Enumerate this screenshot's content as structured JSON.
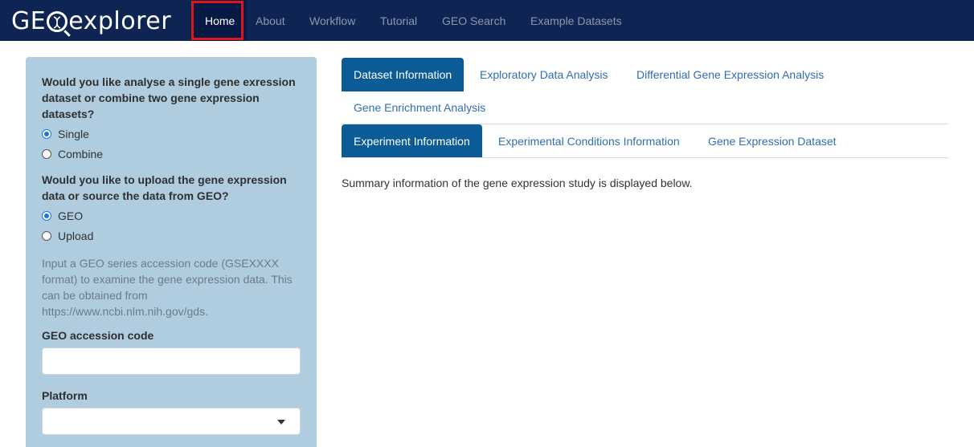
{
  "navbar": {
    "brand_prefix": "GE",
    "brand_suffix": "explorer",
    "items": [
      {
        "label": "Home",
        "active": true
      },
      {
        "label": "About"
      },
      {
        "label": "Workflow"
      },
      {
        "label": "Tutorial"
      },
      {
        "label": "GEO Search"
      },
      {
        "label": "Example Datasets"
      }
    ]
  },
  "sidebar": {
    "q1": "Would you like analyse a single gene exression dataset or combine two gene expression datasets?",
    "q1_options": [
      {
        "label": "Single",
        "checked": true
      },
      {
        "label": "Combine",
        "checked": false
      }
    ],
    "q2": "Would you like to upload the gene expression data or source the data from GEO?",
    "q2_options": [
      {
        "label": "GEO",
        "checked": true
      },
      {
        "label": "Upload",
        "checked": false
      }
    ],
    "help_text": "Input a GEO series accession code (GSEXXXX format) to examine the gene expression data. This can be obtained from https://www.ncbi.nlm.nih.gov/gds.",
    "accession_label": "GEO accession code",
    "accession_value": "",
    "platform_label": "Platform",
    "platform_value": ""
  },
  "main": {
    "tabs": [
      {
        "label": "Dataset Information",
        "active": true
      },
      {
        "label": "Exploratory Data Analysis"
      },
      {
        "label": "Differential Gene Expression Analysis"
      },
      {
        "label": "Gene Enrichment Analysis"
      }
    ],
    "subtabs": [
      {
        "label": "Experiment Information",
        "active": true
      },
      {
        "label": "Experimental Conditions Information"
      },
      {
        "label": "Gene Expression Dataset"
      }
    ],
    "summary": "Summary information of the gene expression study is displayed below."
  },
  "colors": {
    "navbar_bg": "#0e2453",
    "active_tab": "#0b5c96",
    "sidebar_bg": "#b0cde0",
    "highlight": "#e0151a",
    "link": "#2f6fb0"
  }
}
